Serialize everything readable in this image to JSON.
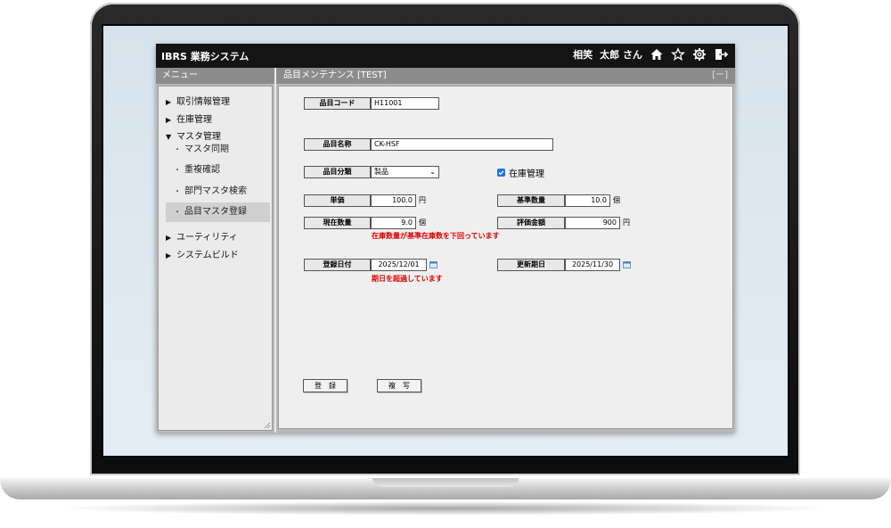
{
  "app": {
    "title": "IBRS 業務システム",
    "user_company": "相笑",
    "user_name": "太郎 さん",
    "icons": [
      "home-icon",
      "star-icon",
      "gear-icon",
      "logout-icon"
    ]
  },
  "sidebar": {
    "header": "メニュー",
    "items": [
      {
        "label": "取引情報管理",
        "arrow": "▶"
      },
      {
        "label": "在庫管理",
        "arrow": "▶"
      },
      {
        "label": "マスタ管理",
        "arrow": "▼"
      },
      {
        "label": "ユーティリティ",
        "arrow": "▶"
      },
      {
        "label": "システムビルド",
        "arrow": "▶"
      }
    ],
    "sub_items": [
      {
        "label": "マスタ同期",
        "bullet": "・"
      },
      {
        "label": "重複確認",
        "bullet": "・"
      },
      {
        "label": "部門マスタ検索",
        "bullet": "・"
      },
      {
        "label": "品目マスタ登録",
        "bullet": "・",
        "active": true
      }
    ]
  },
  "content": {
    "header": "品目メンテナンス [TEST]",
    "collapse_label": "[ー]"
  },
  "form": {
    "item_code": {
      "label": "品目コード",
      "value": "H11001"
    },
    "item_name": {
      "label": "品目名称",
      "value": "CK-HSF"
    },
    "item_category": {
      "label": "品目分類",
      "value": "製品"
    },
    "inventory_management": {
      "label": "在庫管理",
      "checked": true
    },
    "unit_price": {
      "label": "単価",
      "value": "100.0",
      "unit": "円"
    },
    "standard_quantity": {
      "label": "基準数量",
      "value": "10.0",
      "unit": "個"
    },
    "current_quantity": {
      "label": "現在数量",
      "value": "9.0",
      "unit": "個",
      "warning": "在庫数量が基準在庫数を下回っています"
    },
    "valuation_amount": {
      "label": "評価金額",
      "value": "900",
      "unit": "円"
    },
    "registration_date": {
      "label": "登録日付",
      "value": "2025/12/01",
      "warning": "期日を超過しています"
    },
    "update_date": {
      "label": "更新期日",
      "value": "2025/11/30"
    }
  },
  "buttons": {
    "register": "登　録",
    "copy": "複　写"
  },
  "colors": {
    "topbar": "#141414",
    "header_bar": "#8c8c8c",
    "warning": "#e00000",
    "checkbox": "#1a73e8"
  }
}
